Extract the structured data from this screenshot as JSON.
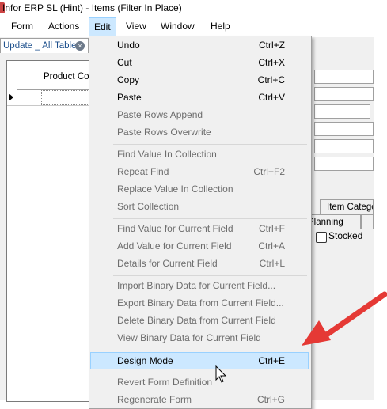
{
  "window": {
    "title": "Infor ERP SL (Hint) - Items (Filter In Place)"
  },
  "menubar": {
    "items": [
      {
        "label": "Form"
      },
      {
        "label": "Actions"
      },
      {
        "label": "Edit"
      },
      {
        "label": "View"
      },
      {
        "label": "Window"
      },
      {
        "label": "Help"
      }
    ]
  },
  "doctab": {
    "label": "Update _ All Tables",
    "close": "×"
  },
  "grid": {
    "column_header": "Product Cod"
  },
  "form": {
    "stocked_label": "Stocked",
    "tabs": [
      {
        "label": "Item Catego"
      },
      {
        "label": "Planning"
      }
    ]
  },
  "edit_menu": {
    "items": [
      {
        "label": "Undo",
        "shortcut": "Ctrl+Z",
        "enabled": true
      },
      {
        "label": "Cut",
        "shortcut": "Ctrl+X",
        "enabled": true
      },
      {
        "label": "Copy",
        "shortcut": "Ctrl+C",
        "enabled": true
      },
      {
        "label": "Paste",
        "shortcut": "Ctrl+V",
        "enabled": true
      },
      {
        "label": "Paste Rows Append",
        "shortcut": "",
        "enabled": false
      },
      {
        "label": "Paste Rows Overwrite",
        "shortcut": "",
        "enabled": false
      },
      {
        "label": "Find Value In Collection",
        "shortcut": "",
        "enabled": false
      },
      {
        "label": "Repeat Find",
        "shortcut": "Ctrl+F2",
        "enabled": false
      },
      {
        "label": "Replace Value In Collection",
        "shortcut": "",
        "enabled": false
      },
      {
        "label": "Sort Collection",
        "shortcut": "",
        "enabled": false
      },
      {
        "label": "Find Value for Current Field",
        "shortcut": "Ctrl+F",
        "enabled": false
      },
      {
        "label": "Add Value for Current Field",
        "shortcut": "Ctrl+A",
        "enabled": false
      },
      {
        "label": "Details for Current Field",
        "shortcut": "Ctrl+L",
        "enabled": false
      },
      {
        "label": "Import Binary Data for Current Field...",
        "shortcut": "",
        "enabled": false
      },
      {
        "label": "Export Binary Data from Current Field...",
        "shortcut": "",
        "enabled": false
      },
      {
        "label": "Delete Binary Data from Current Field",
        "shortcut": "",
        "enabled": false
      },
      {
        "label": "View Binary Data for Current Field",
        "shortcut": "",
        "enabled": false
      },
      {
        "label": "Design Mode",
        "shortcut": "Ctrl+E",
        "enabled": true
      },
      {
        "label": "Revert Form Definition",
        "shortcut": "",
        "enabled": false
      },
      {
        "label": "Regenerate Form",
        "shortcut": "Ctrl+G",
        "enabled": false
      }
    ]
  },
  "colors": {
    "highlight_bg": "#cce8ff",
    "highlight_border": "#99d1ff",
    "annotation_arrow": "#e53935",
    "disabled_text": "#6d6d6d"
  }
}
